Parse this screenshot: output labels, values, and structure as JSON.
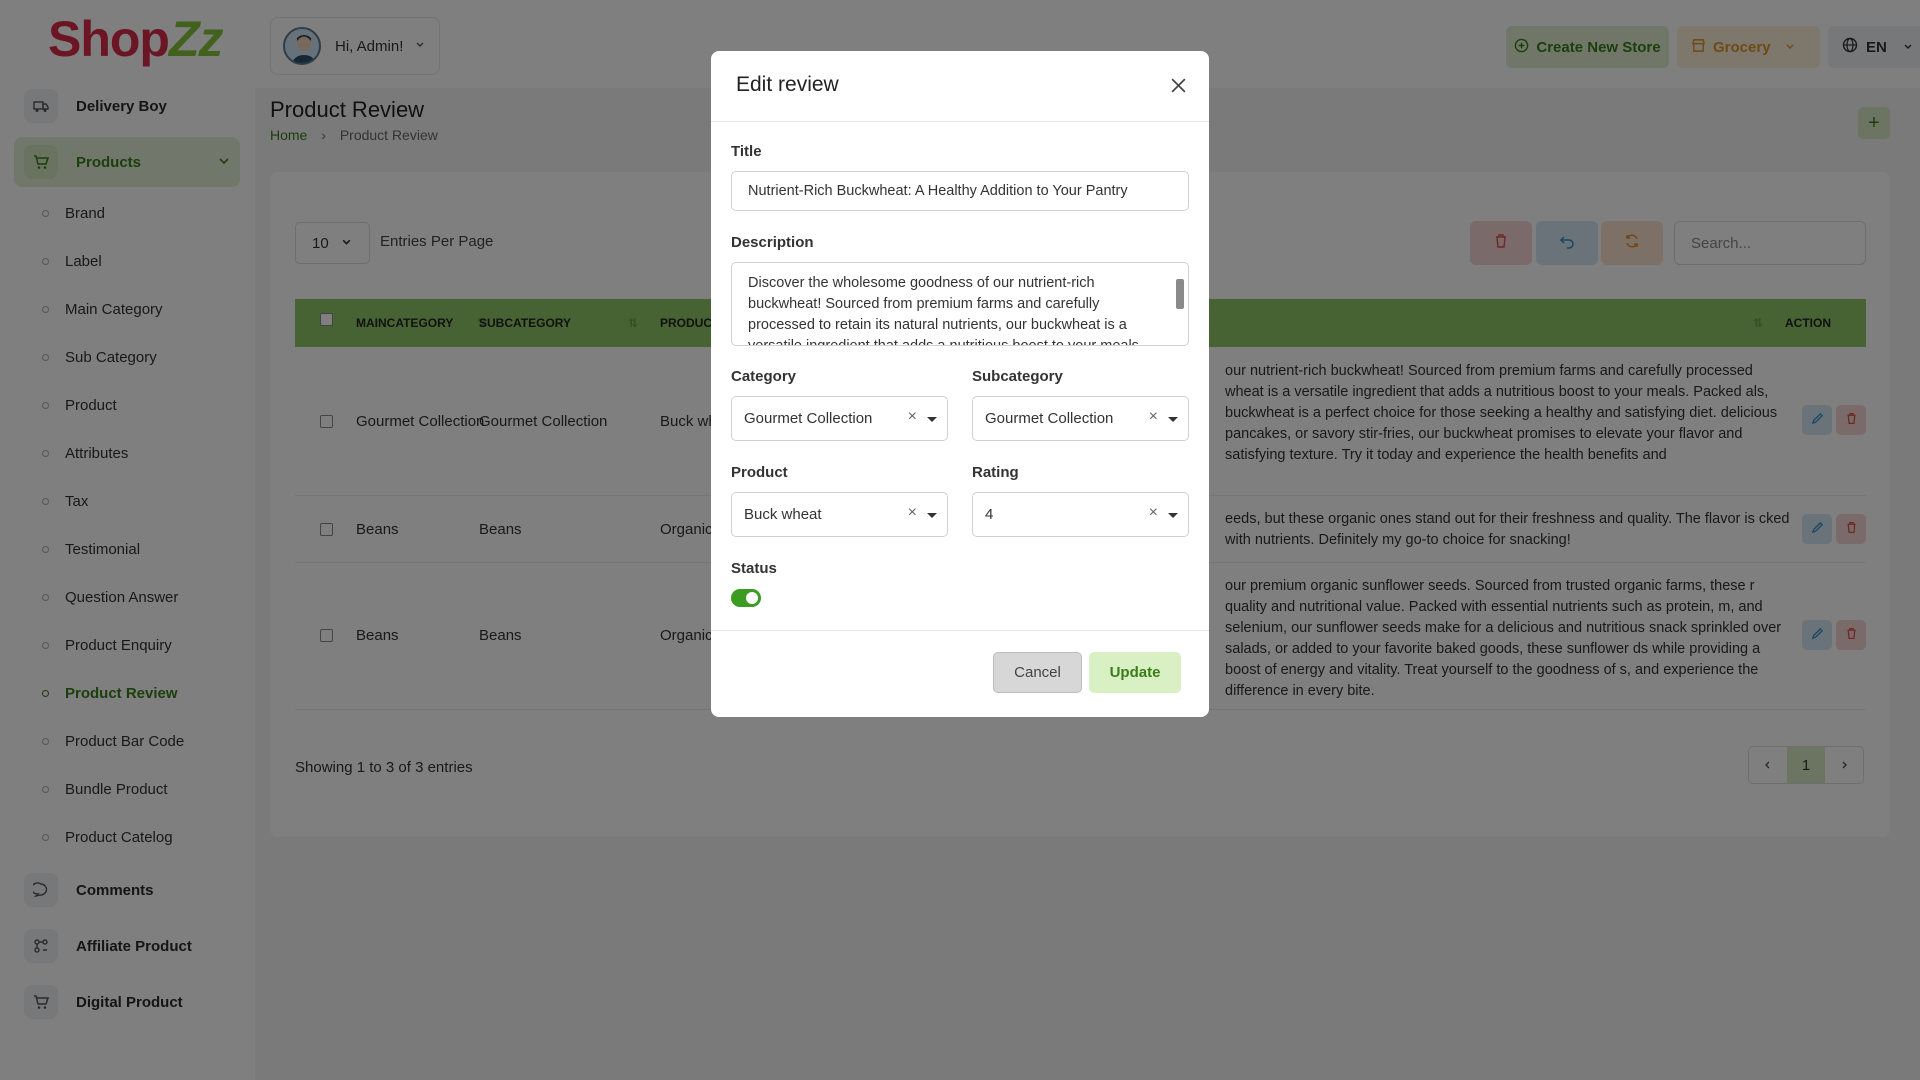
{
  "sidebar": {
    "logo_main": "Shop",
    "logo_accent": "Zz",
    "delivery_boy": "Delivery Boy",
    "products": "Products",
    "sub_items": [
      "Brand",
      "Label",
      "Main Category",
      "Sub Category",
      "Product",
      "Attributes",
      "Tax",
      "Testimonial",
      "Question Answer",
      "Product Enquiry",
      "Product Review",
      "Product Bar Code",
      "Bundle Product",
      "Product Catelog"
    ],
    "active_sub": "Product Review",
    "comments": "Comments",
    "affiliate": "Affiliate Product",
    "digital": "Digital Product"
  },
  "header": {
    "greeting": "Hi, Admin!",
    "create_store": "Create New Store",
    "grocery": "Grocery",
    "lang": "EN"
  },
  "page": {
    "title": "Product Review",
    "breadcrumb_home": "Home",
    "breadcrumb_current": "Product Review",
    "add_icon": "+"
  },
  "table": {
    "entries_value": "10",
    "entries_label": "Entries Per Page",
    "search_placeholder": "Search...",
    "columns": [
      "MAINCATEGORY",
      "SUBCATEGORY",
      "PRODUCT",
      "ACTION"
    ],
    "rows": [
      {
        "maincategory": "Gourmet Collection",
        "subcategory": "Gourmet Collection",
        "product": "Buck wh",
        "description": "our nutrient-rich buckwheat! Sourced from premium farms and carefully processed wheat is a versatile ingredient that adds a nutritious boost to your meals. Packed als, buckwheat is a perfect choice for those seeking a healthy and satisfying diet. delicious pancakes, or savory stir-fries, our buckwheat promises to elevate your flavor and satisfying texture. Try it today and experience the health benefits and"
      },
      {
        "maincategory": "Beans",
        "subcategory": "Beans",
        "product": "Organic",
        "description": "eeds, but these organic ones stand out for their freshness and quality. The flavor is cked with nutrients. Definitely my go-to choice for snacking!"
      },
      {
        "maincategory": "Beans",
        "subcategory": "Beans",
        "product": "Organic",
        "description": "our premium organic sunflower seeds. Sourced from trusted organic farms, these r quality and nutritional value. Packed with essential nutrients such as protein, m, and selenium, our sunflower seeds make for a delicious and nutritious snack sprinkled over salads, or added to your favorite baked goods, these sunflower ds while providing a boost of energy and vitality. Treat yourself to the goodness of s, and experience the difference in every bite."
      }
    ],
    "showing": "Showing 1 to 3 of 3 entries",
    "page": "1"
  },
  "modal": {
    "title": "Edit review",
    "title_label": "Title",
    "title_value": "Nutrient-Rich Buckwheat: A Healthy Addition to Your Pantry",
    "description_label": "Description",
    "description_value": "Discover the wholesome goodness of our nutrient-rich buckwheat! Sourced from premium farms and carefully processed to retain its natural nutrients, our buckwheat is a versatile ingredient that adds a nutritious boost to your meals.",
    "category_label": "Category",
    "category_value": "Gourmet Collection",
    "subcategory_label": "Subcategory",
    "subcategory_value": "Gourmet Collection",
    "product_label": "Product",
    "product_value": "Buck wheat",
    "rating_label": "Rating",
    "rating_value": "4",
    "status_label": "Status",
    "status_on": true,
    "cancel": "Cancel",
    "update": "Update",
    "clear_symbol": "×"
  },
  "colors": {
    "brand_green": "#3b7d1a",
    "table_header": "#8fc567",
    "logo_red": "#d62b4b"
  }
}
